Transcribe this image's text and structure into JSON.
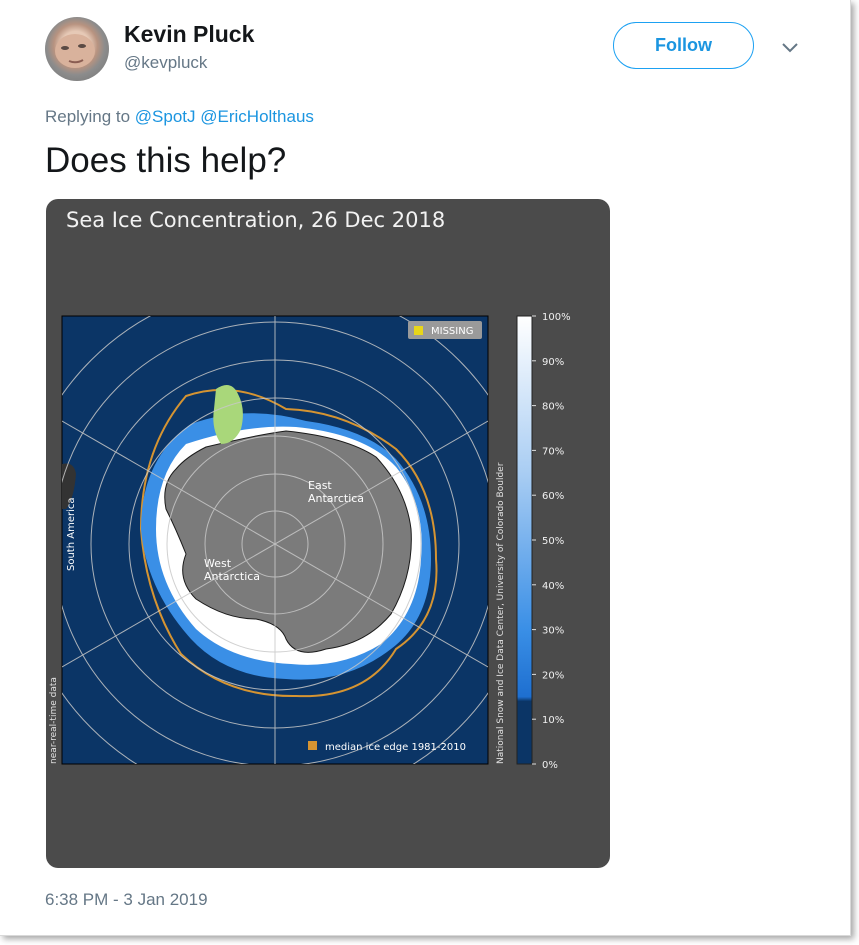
{
  "tweet": {
    "author_name": "Kevin Pluck",
    "author_handle": "@kevpluck",
    "follow_label": "Follow",
    "replying_prefix": "Replying to",
    "reply_mentions": [
      "@SpotJ",
      "@EricHolthaus"
    ],
    "text": "Does this help?",
    "timestamp": "6:38 PM - 3 Jan 2019"
  },
  "media": {
    "title": "Sea Ice Concentration, 26 Dec 2018",
    "legend_missing": "MISSING",
    "legend_median": "median ice edge 1981-2010",
    "label_east": [
      "East",
      "Antarctica"
    ],
    "label_west": [
      "West",
      "Antarctica"
    ],
    "label_south_america": "South America",
    "side_left": "near-real-time data",
    "side_right": "National Snow and Ice Data Center, University of Colorado Boulder",
    "colorbar_ticks": [
      "100%",
      "90%",
      "80%",
      "70%",
      "60%",
      "50%",
      "40%",
      "30%",
      "20%",
      "10%",
      "0%"
    ],
    "colors": {
      "ocean": "#0b3566",
      "land": "#7b7b7b",
      "ice_high": "#ffffff",
      "ice_mid": "#3a8fe6",
      "median_edge": "#d59432",
      "missing": "#e8d61a",
      "other_land": "#a9d77a"
    }
  },
  "icons": {
    "more": "chevron-down-icon"
  }
}
